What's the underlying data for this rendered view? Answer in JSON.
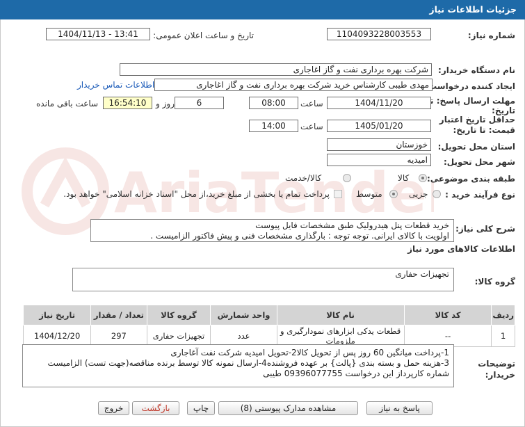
{
  "header": {
    "title": "جزئیات اطلاعات نیاز"
  },
  "watermark": {
    "text": "AriaTender.neT"
  },
  "fields": {
    "need_number_label": "شماره نیاز:",
    "need_number": "1104093228003553",
    "announce_label": "تاریخ و ساعت اعلان عمومی:",
    "announce_value": "1404/11/13 - 13:41",
    "buyer_label": "نام دستگاه خریدار:",
    "buyer_value": "شرکت بهره برداری نفت و گاز اغاجاری",
    "creator_label": "ایجاد کننده درخواست:",
    "creator_value": "مهدی طیبی کارشناس خرید شرکت بهره برداری نفت و گاز اغاجاری",
    "contact_link": "اطلاعات تماس خریدار",
    "deadline_label_1": "مهلت ارسال پاسخ: تا",
    "deadline_label_2": "تاریخ:",
    "deadline_date": "1404/11/20",
    "time_label": "ساعت",
    "deadline_time": "08:00",
    "days_value": "6",
    "days_label": "روز و",
    "remaining_time": "16:54:10",
    "remaining_label": "ساعت باقی مانده",
    "validity_label_1": "حداقل تاریخ اعتبار",
    "validity_label_2": "قیمت: تا تاریخ:",
    "validity_date": "1405/01/20",
    "validity_time": "14:00",
    "province_label": "استان محل تحویل:",
    "province_value": "خوزستان",
    "city_label": "شهر محل تحویل:",
    "city_value": "امیدیه",
    "category_label": "طبقه بندی موضوعی:",
    "category_options": [
      "کالا",
      "کالا/خدمت"
    ],
    "process_label": "نوع فرآیند خرید :",
    "process_options": [
      "جزیی",
      "متوسط"
    ],
    "payment_note": "پرداخت تمام یا بخشی از مبلغ خرید،از محل \"اسناد خزانه اسلامی\" خواهد بود."
  },
  "description": {
    "label": "شرح کلی نیاز:",
    "line1": "خرید قطعات پنل هیدرولیک طبق مشخصات فایل پیوست",
    "line2": "اولویت با کالای ایرانی. توجه توجه : بارگذاری مشخصات فنی و پیش فاکتور الزامیست ."
  },
  "goods_info_title": "اطلاعات کالاهای مورد نیاز",
  "goods_group": {
    "label": "گروه کالا:",
    "value": "تجهیزات حفاری"
  },
  "table": {
    "headers": [
      "ردیف",
      "کد کالا",
      "نام کالا",
      "واحد شمارش",
      "گروه کالا",
      "تعداد / مقدار",
      "تاریخ نیاز"
    ],
    "rows": [
      [
        "1",
        "--",
        "قطعات یدکی ابزارهای نمودارگیری و ملزومات",
        "عدد",
        "تجهیزات حفاری",
        "297",
        "1404/12/20"
      ]
    ]
  },
  "buyer_notes": {
    "label_1": "توضیحات",
    "label_2": "خریدار:",
    "line1": "1-پرداخت میانگین 60 روز پس از تحویل کالا2-تحویل امیدیه شرکت نفت آغاجاری",
    "line2": "3-هزینه حمل  و بسته بندی {پالت} بر عهده فروشنده4-ارسال نمونه کالا توسط برنده مناقصه(جهت تست) الزامیست",
    "line3": "شماره کارپرداز این درخواست 09396077755 طیبی"
  },
  "buttons": {
    "reply": "پاسخ به نیاز",
    "docs": "مشاهده مدارک پیوستی (8)",
    "print": "چاپ",
    "back": "بازگشت",
    "exit": "خروج"
  },
  "colors": {
    "header": "#1e6aa8",
    "link": "#1a5ab8",
    "remaining_bg": "#ffffc9",
    "back_text": "#c0392b"
  }
}
